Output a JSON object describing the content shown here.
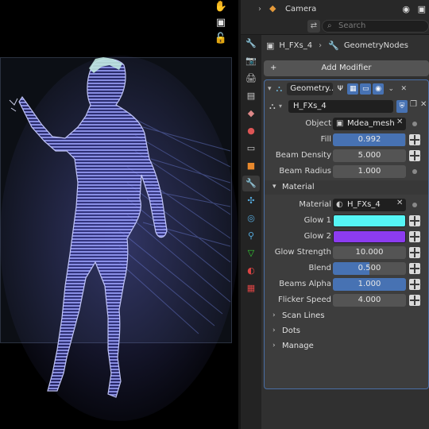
{
  "outliner": {
    "camera_label": "Camera"
  },
  "search": {
    "placeholder": "Search"
  },
  "breadcrumb": {
    "object": "H_FXs_4",
    "modifier": "GeometryNodes"
  },
  "add_modifier": {
    "label": "Add Modifier"
  },
  "modifier": {
    "name": "Geometry...",
    "node_group": "H_FXs_4",
    "fields": {
      "object_label": "Object",
      "object_value": "Mdea_mesh",
      "fill_label": "Fill",
      "fill_value": "0.992",
      "fill_fraction": 0.992,
      "beam_density_label": "Beam Density",
      "beam_density_value": "5.000",
      "beam_radius_label": "Beam Radius",
      "beam_radius_value": "1.000"
    },
    "material_section": {
      "title": "Material",
      "material_label": "Material",
      "material_value": "H_FXs_4",
      "glow1_label": "Glow 1",
      "glow1_color": "#55f5f5",
      "glow2_label": "Glow 2",
      "glow2_color": "#8c3cf0",
      "glow_strength_label": "Glow Strength",
      "glow_strength_value": "10.000",
      "blend_label": "Blend",
      "blend_value": "0.500",
      "blend_fraction": 0.5,
      "beams_alpha_label": "Beams Alpha",
      "beams_alpha_value": "1.000",
      "beams_alpha_fraction": 1.0,
      "flicker_speed_label": "Flicker Speed",
      "flicker_speed_value": "4.000"
    },
    "collapsed_sections": [
      "Scan Lines",
      "Dots",
      "Manage"
    ]
  },
  "colors": {
    "accent": "#4772b3",
    "panel": "#303030",
    "hologram": "#8a8df0"
  }
}
